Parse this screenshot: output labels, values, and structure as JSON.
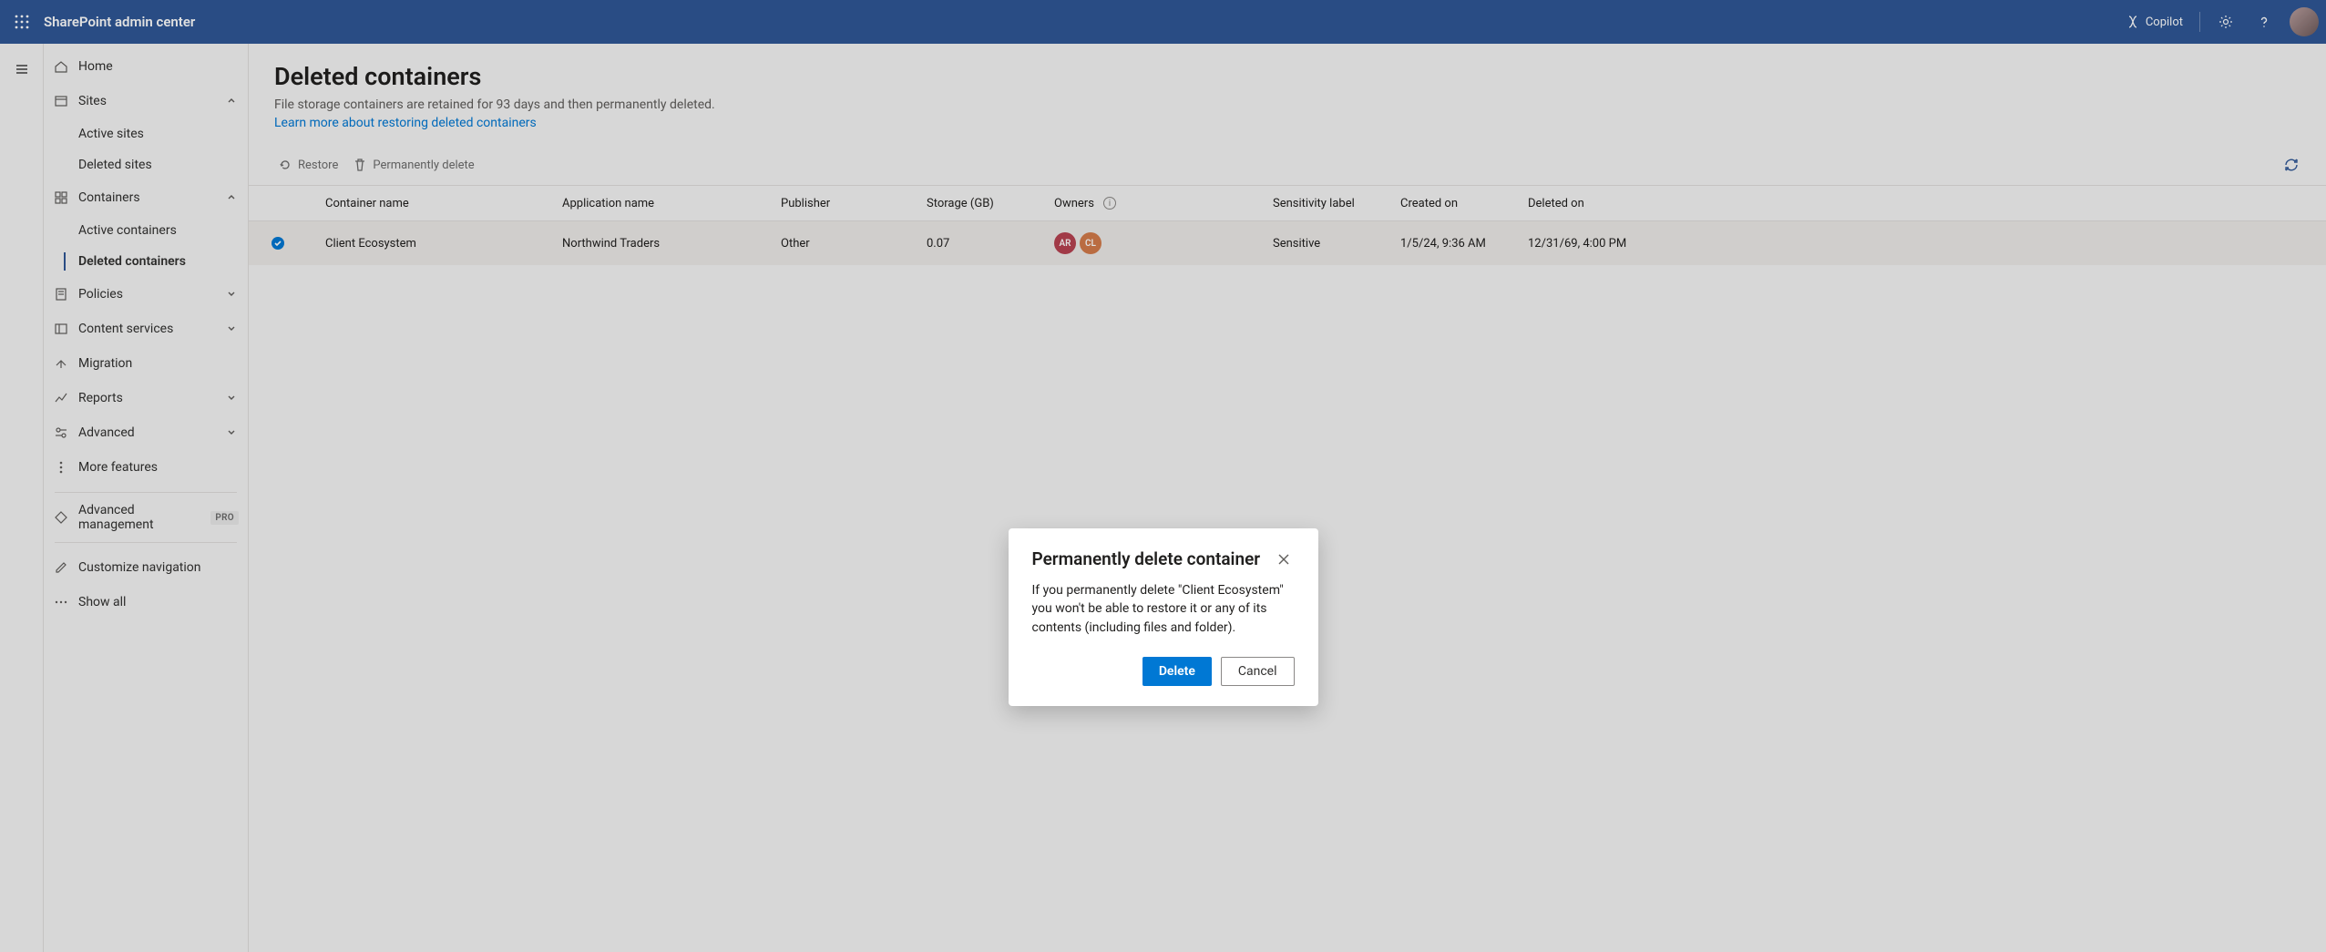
{
  "header": {
    "title": "SharePoint admin center",
    "copilot": "Copilot"
  },
  "nav": {
    "home": "Home",
    "sites": "Sites",
    "active_sites": "Active sites",
    "deleted_sites": "Deleted sites",
    "containers": "Containers",
    "active_containers": "Active containers",
    "deleted_containers": "Deleted containers",
    "policies": "Policies",
    "content_services": "Content services",
    "migration": "Migration",
    "reports": "Reports",
    "advanced": "Advanced",
    "more_features": "More features",
    "advanced_management": "Advanced management",
    "pro_tag": "PRO",
    "customize_navigation": "Customize navigation",
    "show_all": "Show all"
  },
  "page": {
    "title": "Deleted containers",
    "subtitle": "File storage containers are retained for 93 days and then permanently deleted.",
    "learn_more": "Learn more about restoring deleted containers"
  },
  "toolbar": {
    "restore": "Restore",
    "perm_delete": "Permanently delete"
  },
  "columns": {
    "container_name": "Container name",
    "application_name": "Application name",
    "publisher": "Publisher",
    "storage": "Storage (GB)",
    "owners": "Owners",
    "sensitivity": "Sensitivity label",
    "created_on": "Created on",
    "deleted_on": "Deleted on"
  },
  "rows": [
    {
      "container_name": "Client Ecosystem",
      "application_name": "Northwind Traders",
      "publisher": "Other",
      "storage": "0.07",
      "owner1": "AR",
      "owner2": "CL",
      "sensitivity": "Sensitive",
      "created_on": "1/5/24, 9:36 AM",
      "deleted_on": "12/31/69, 4:00 PM",
      "selected": true
    }
  ],
  "dialog": {
    "title": "Permanently delete container",
    "body": "If you permanently delete \"Client Ecosystem\" you won't be able to restore it or any of its contents (including files and folder).",
    "delete": "Delete",
    "cancel": "Cancel"
  }
}
